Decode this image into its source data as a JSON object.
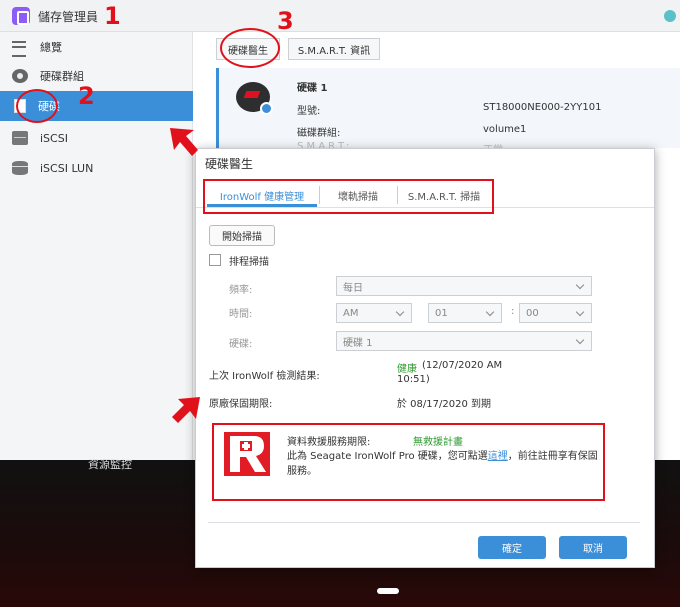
{
  "app": {
    "title": "儲存管理員"
  },
  "sidebar": {
    "items": [
      {
        "label": "總覽",
        "icon": "list-icon"
      },
      {
        "label": "硬碟群組",
        "icon": "disc-icon"
      },
      {
        "label": "硬碟",
        "icon": "drive-icon"
      },
      {
        "label": "iSCSI",
        "icon": "server-icon"
      },
      {
        "label": "iSCSI LUN",
        "icon": "database-icon"
      }
    ],
    "active": "硬碟"
  },
  "toolbar": {
    "doctor_label": "硬碟醫生",
    "smart_label": "S.M.A.R.T. 資訊"
  },
  "disk": {
    "name": "硬碟 1",
    "model_label": "型號:",
    "model_value": "ST18000NE000-2YY101",
    "volume_label": "磁碟群組:",
    "volume_value": "volume1",
    "obscured_label": "S.M.A.R.T.:",
    "obscured_value": "正常"
  },
  "background": {
    "resource_monitor": "資源監控"
  },
  "dialog": {
    "title": "硬碟醫生",
    "tabs": [
      "IronWolf 健康管理",
      "壞軌掃描",
      "S.M.A.R.T. 掃描"
    ],
    "active_tab": "IronWolf 健康管理",
    "start_button": "開始掃描",
    "schedule_label": "排程掃描",
    "frequency_label": "頻率:",
    "frequency_value": "每日",
    "time_label": "時間:",
    "time_ampm": "AM",
    "time_hour": "01",
    "time_minute": "00",
    "colon": ":",
    "disk_label": "硬碟:",
    "disk_value": "硬碟 1",
    "last_result_label": "上次 IronWolf 檢測結果:",
    "last_result_status": "健康",
    "last_result_date": "(12/07/2020 AM",
    "last_result_time": "10:51)",
    "warranty_label": "原廠保固期限:",
    "warranty_value": "於 08/17/2020 到期",
    "rescue": {
      "label": "資料救援服務期限:",
      "plan": "無救援計畫",
      "desc_prefix": "此為 Seagate IronWolf Pro 硬碟，您可點選",
      "link": "這裡",
      "desc_suffix": "，前往註冊享有保固",
      "desc_line2": "服務。"
    },
    "ok_button": "確定",
    "cancel_button": "取消"
  },
  "annotations": {
    "one": "1",
    "two": "2",
    "three": "3",
    "color": "#e0111b"
  },
  "colors": {
    "accent": "#3b8fd8",
    "health": "#2e9a2e",
    "logo_red": "#e11c24"
  }
}
